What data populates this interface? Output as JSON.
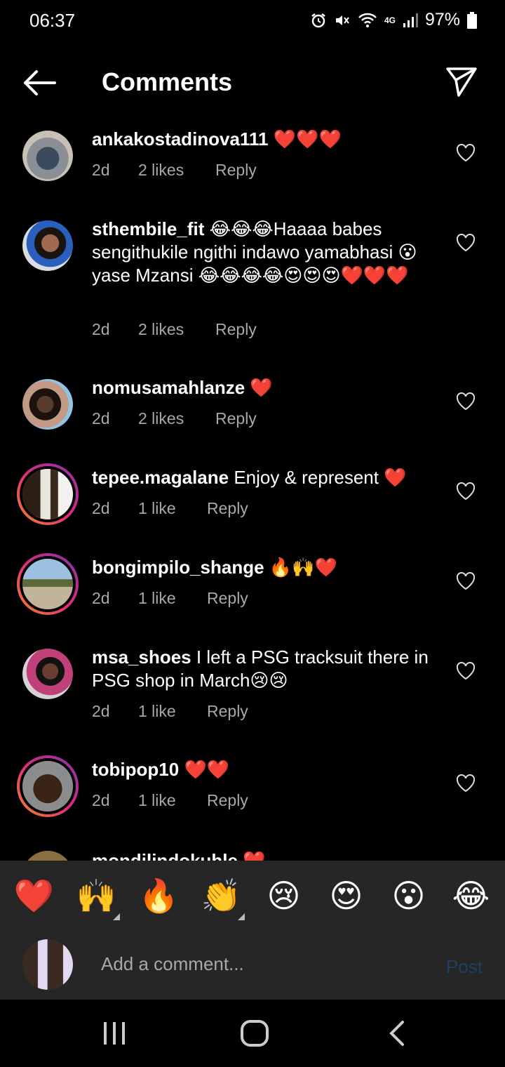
{
  "status": {
    "time": "06:37",
    "network": "4G",
    "battery": "97%"
  },
  "header": {
    "title": "Comments"
  },
  "comments": [
    {
      "username": "ankakostadinova111",
      "text": " ❤️❤️❤️",
      "time": "2d",
      "likes": "2 likes",
      "reply": "Reply"
    },
    {
      "username": "sthembile_fit",
      "text": " 😂😂😂Haaaa babes sengithukile ngithi indawo yamabhasi 😮yase Mzansi 😂😂😂😂😍😍😍❤️❤️❤️",
      "time": "2d",
      "likes": "2 likes",
      "reply": "Reply"
    },
    {
      "username": "nomusamahlanze",
      "text": " ❤️",
      "time": "2d",
      "likes": "2 likes",
      "reply": "Reply"
    },
    {
      "username": "tepee.magalane",
      "text": " Enjoy & represent ❤️",
      "time": "2d",
      "likes": "1 like",
      "reply": "Reply"
    },
    {
      "username": "bongimpilo_shange",
      "text": " 🔥🙌❤️",
      "time": "2d",
      "likes": "1 like",
      "reply": "Reply"
    },
    {
      "username": "msa_shoes",
      "text": " I left a PSG tracksuit there in PSG shop in March😢😢",
      "time": "2d",
      "likes": "1 like",
      "reply": "Reply"
    },
    {
      "username": "tobipop10",
      "text": " ❤️❤️",
      "time": "2d",
      "likes": "1 like",
      "reply": "Reply"
    },
    {
      "username": "mondilindokuhle",
      "text": " ❤️"
    }
  ],
  "emoji_bar": [
    "❤️",
    "🙌",
    "🔥",
    "👏",
    "😢",
    "😍",
    "😮",
    "😂"
  ],
  "composer": {
    "placeholder": "Add a comment...",
    "post": "Post"
  },
  "colors": {
    "background": "#000000",
    "panel": "#262626",
    "meta_text": "#a8a8a8",
    "post_disabled": "#1e3f63"
  }
}
